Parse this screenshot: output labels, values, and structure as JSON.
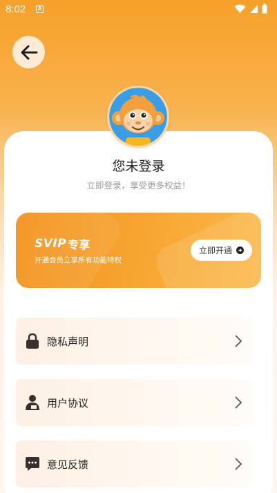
{
  "status_bar": {
    "time": "8:02",
    "notif_letter": "A"
  },
  "profile": {
    "title": "您未登录",
    "subtitle": "立即登录，享受更多权益！"
  },
  "vip": {
    "logo": "SVIP",
    "exclusive": "专享",
    "description": "开通会员立享所有功能特权",
    "button_label": "立即开通"
  },
  "menu": {
    "items": [
      {
        "label": "隐私声明",
        "icon": "lock-icon"
      },
      {
        "label": "用户协议",
        "icon": "user-icon"
      },
      {
        "label": "意见反馈",
        "icon": "feedback-icon"
      }
    ]
  },
  "colors": {
    "accent": "#f6a02a",
    "icon": "#3b2e2e"
  }
}
